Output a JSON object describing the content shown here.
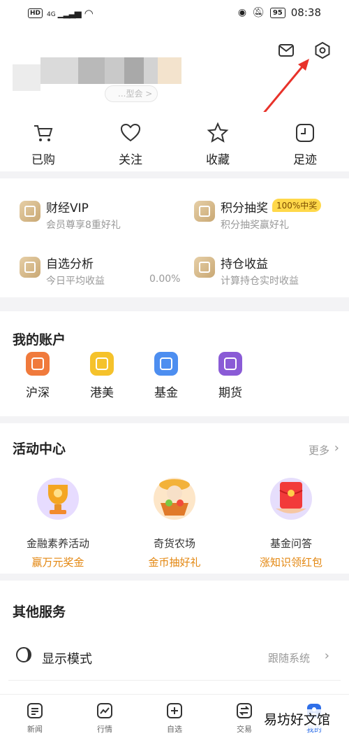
{
  "status_bar": {
    "network": "HD",
    "signal_gen": "4G",
    "battery": "95",
    "time": "08:38"
  },
  "header": {
    "vip_pill": "...型会 >"
  },
  "quick_links": [
    {
      "label": "已购",
      "icon": "cart-icon"
    },
    {
      "label": "关注",
      "icon": "heart-icon"
    },
    {
      "label": "收藏",
      "icon": "star-icon"
    },
    {
      "label": "足迹",
      "icon": "history-icon"
    }
  ],
  "services": [
    {
      "title": "财经VIP",
      "subtitle": "会员尊享8重好礼"
    },
    {
      "title": "积分抽奖",
      "subtitle": "积分抽奖赢好礼",
      "badge": "100%中奖"
    },
    {
      "title": "自选分析",
      "subtitle": "今日平均收益",
      "value": "0.00%"
    },
    {
      "title": "持仓收益",
      "subtitle": "计算持仓实时收益"
    }
  ],
  "accounts": {
    "title": "我的账户",
    "items": [
      {
        "label": "沪深",
        "color": "#f07a3c"
      },
      {
        "label": "港美",
        "color": "#f5c22b"
      },
      {
        "label": "基金",
        "color": "#4d8ef0"
      },
      {
        "label": "期货",
        "color": "#8a5bd6"
      }
    ]
  },
  "activities": {
    "title": "活动中心",
    "more": "更多",
    "items": [
      {
        "name": "金融素养活动",
        "subtitle": "赢万元奖金"
      },
      {
        "name": "奇货农场",
        "subtitle": "金币抽好礼"
      },
      {
        "name": "基金问答",
        "subtitle": "涨知识领红包"
      }
    ]
  },
  "other": {
    "title": "其他服务",
    "display_mode": {
      "label": "显示模式",
      "value": "跟随系统"
    }
  },
  "tabs": [
    {
      "label": "新闻"
    },
    {
      "label": "行情"
    },
    {
      "label": "自选"
    },
    {
      "label": "交易"
    },
    {
      "label": "我的",
      "active": true
    }
  ],
  "watermark": "易坊好文馆",
  "colors": {
    "accent": "#2f6fe8",
    "gold": "#e3860f",
    "badge": "#ffd84a",
    "annotation": "#e8322a"
  }
}
